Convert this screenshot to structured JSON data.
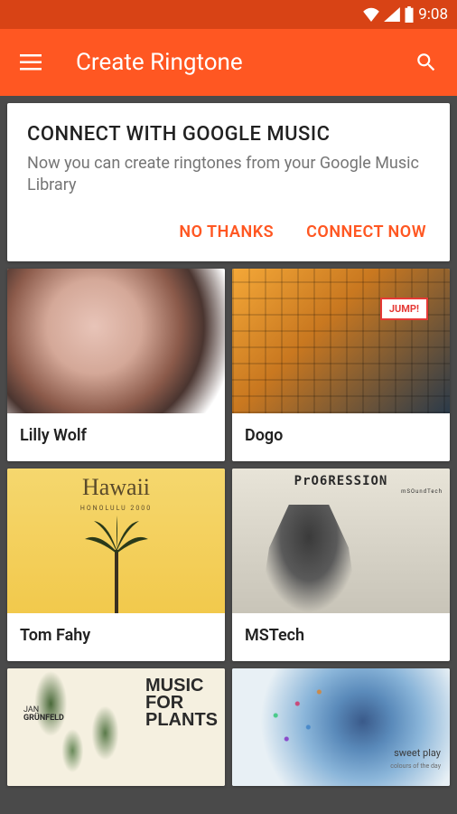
{
  "status": {
    "time": "9:08"
  },
  "appbar": {
    "title": "Create Ringtone"
  },
  "promo": {
    "title": "CONNECT WITH GOOGLE MUSIC",
    "description": "Now you can create ringtones from your Google Music Library",
    "no_thanks": "NO THANKS",
    "connect_now": "CONNECT NOW"
  },
  "albums": [
    {
      "title": "Lilly Wolf",
      "art_text": ""
    },
    {
      "title": "Dogo",
      "art_text": "JUMP!"
    },
    {
      "title": "Tom Fahy",
      "art_text": "Hawaii",
      "art_sub": "HONOLULU 2000"
    },
    {
      "title": "MSTech",
      "art_text": "PrO6RESSION",
      "art_sub": "mSOundTech"
    },
    {
      "title": "",
      "art_text": "MUSIC FOR PLANTS",
      "art_author_first": "JAN",
      "art_author_last": "GRÜNFELD"
    },
    {
      "title": "",
      "art_text": "sweet play",
      "art_sub": "colours of the day"
    }
  ]
}
